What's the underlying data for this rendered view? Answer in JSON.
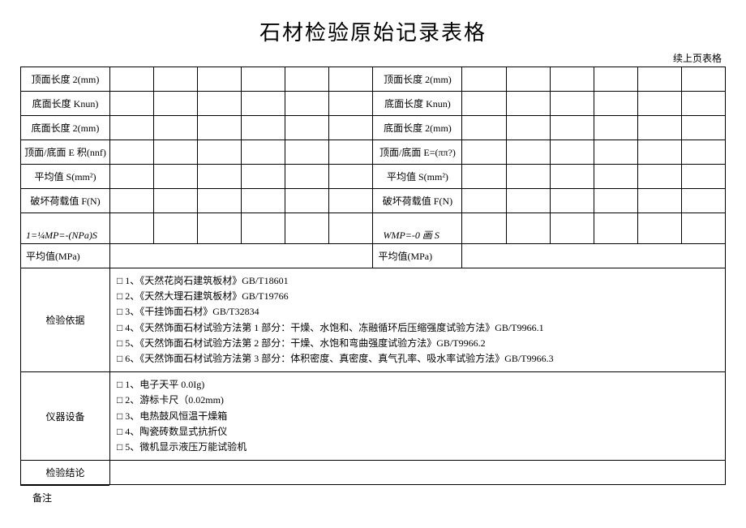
{
  "header": {
    "title": "石材检验原始记录表格",
    "continuation": "续上页表格"
  },
  "rows": {
    "r1_left": "顶面长度 2(mm)",
    "r1_right": "顶面长度 2(mm)",
    "r2_left": "底面长度 Knun)",
    "r2_right": "底面长度 Knun)",
    "r3_left": "底面长度 2(mm)",
    "r3_right": "底面长度 2(mm)",
    "r4_left": "顶面/底面 E 积(nnf)",
    "r4_right": "顶面/底面 E=(ππ?)",
    "r5_left": "平均值 S(mm²)",
    "r5_right": "平均值 S(mm²)",
    "r6_left": "破坏荷载值 F(N)",
    "r6_right": "破坏荷载值 F(N)",
    "r7_left": "1=¼MP=-(NPa)S",
    "r7_right": "WMP=-0 画 S",
    "r8_left": "平均值(MPa)",
    "r8_right": "平均值(MPa)"
  },
  "inspection_basis": {
    "label": "检验依据",
    "items": [
      "□  1、《天然花岗石建筑板材》GB/T18601",
      "□  2、《天然大理石建筑板材》GB/T19766",
      "□  3、《干挂饰面石材》GB/T32834",
      "□  4、《天然饰面石材试验方法第 1 部分：干燥、水饱和、冻融循环后压缩强度试验方法》GB/T9966.1",
      "□  5、《天然饰面石材试验方法第 2 部分：干燥、水饱和弯曲强度试验方法》GB/T9966.2",
      "□  6、《天然饰面石材试验方法第 3 部分：体积密度、真密度、真气孔率、吸水率试验方法》GB/T9966.3"
    ]
  },
  "equipment": {
    "label": "仪器设备",
    "items": [
      "□ 1、电子天平  0.0Ig)",
      "□ 2、游标卡尺（0.02mm)",
      "□ 3、电热鼓风恒温干燥箱",
      "□ 4、陶瓷砖数显式抗折仪",
      "□ 5、微机显示液压万能试验机"
    ]
  },
  "conclusion": {
    "label": "检验结论"
  },
  "remarks": {
    "label": "备注"
  }
}
